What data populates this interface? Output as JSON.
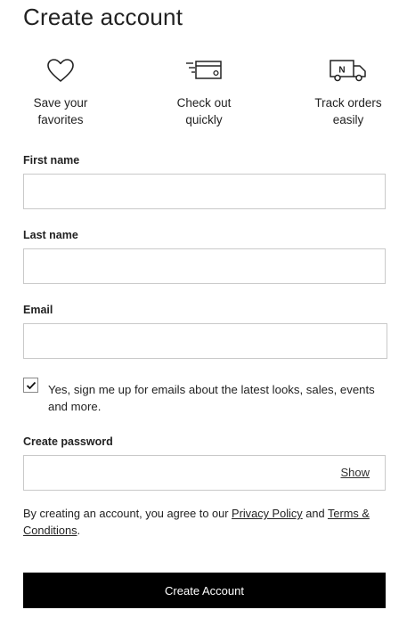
{
  "page": {
    "title": "Create account"
  },
  "benefits": [
    {
      "icon": "heart-icon",
      "line1": "Save your",
      "line2": "favorites"
    },
    {
      "icon": "card-fast-icon",
      "line1": "Check out",
      "line2": "quickly"
    },
    {
      "icon": "truck-icon",
      "line1": "Track orders",
      "line2": "easily",
      "badge": "N"
    }
  ],
  "form": {
    "first_name": {
      "label": "First name",
      "value": ""
    },
    "last_name": {
      "label": "Last name",
      "value": ""
    },
    "email": {
      "label": "Email",
      "value": ""
    },
    "newsletter": {
      "checked": true,
      "text": "Yes, sign me up for emails about the latest looks, sales, events and more."
    },
    "password": {
      "label": "Create password",
      "value": "",
      "show_label": "Show"
    }
  },
  "legal": {
    "prefix": "By creating an account, you agree to our ",
    "privacy_link": "Privacy Policy",
    "middle": " and ",
    "terms_link": "Terms & Conditions",
    "suffix": "."
  },
  "submit_label": "Create Account"
}
